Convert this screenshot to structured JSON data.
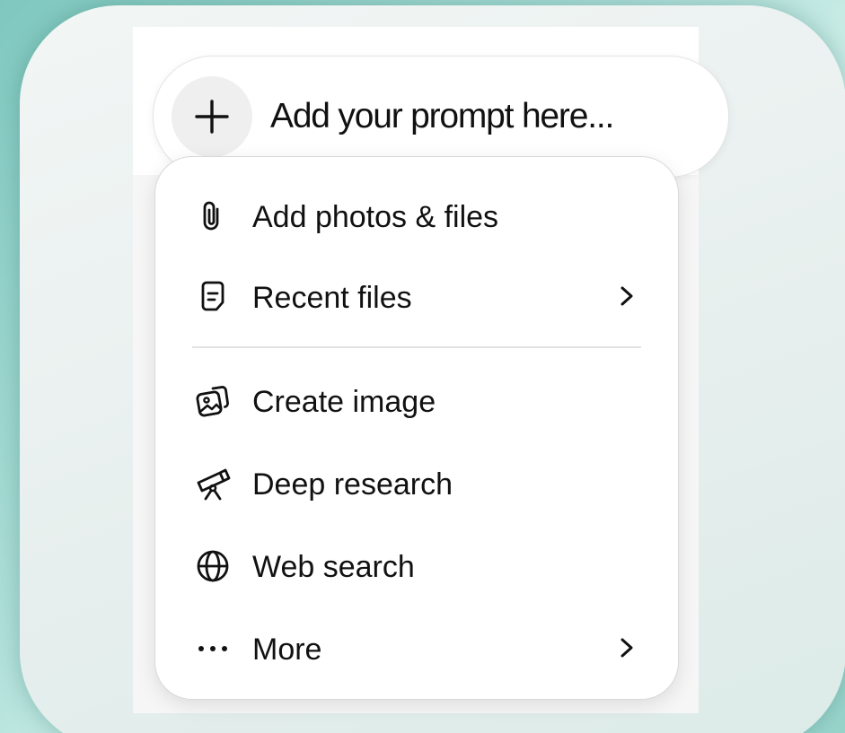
{
  "prompt": {
    "placeholder": "Add your prompt here..."
  },
  "menu": {
    "items": [
      {
        "label": "Add photos & files",
        "icon": "paperclip-icon"
      },
      {
        "label": "Recent files",
        "icon": "file-icon",
        "submenu": true
      },
      {
        "label": "Create image",
        "icon": "image-icon"
      },
      {
        "label": "Deep research",
        "icon": "telescope-icon"
      },
      {
        "label": "Web search",
        "icon": "globe-icon"
      },
      {
        "label": "More",
        "icon": "more-dots-icon",
        "submenu": true
      }
    ]
  },
  "colors": {
    "background_teal": "#a9ddd6",
    "text": "#111111",
    "plus_button_bg": "#efefef"
  }
}
